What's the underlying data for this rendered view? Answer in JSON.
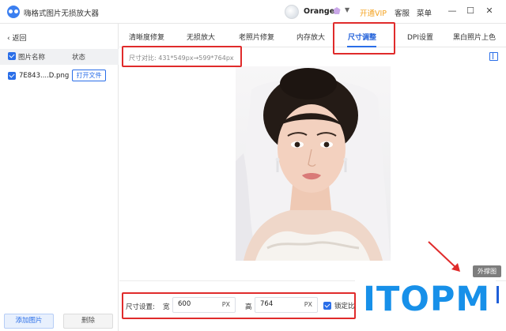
{
  "app": {
    "title": "嗨格式图片无损放大器"
  },
  "user": {
    "name": "Orange",
    "vip_label": "开通VIP",
    "support_label": "客服",
    "menu_label": "菜单"
  },
  "window": {
    "minimize": "—",
    "maximize": "☐",
    "close": "✕"
  },
  "sidebar": {
    "back_label": "返回",
    "columns": {
      "name": "图片名称",
      "status": "状态"
    },
    "files": [
      {
        "name": "7E843....D.png",
        "action": "打开文件"
      }
    ],
    "add_label": "添加图片",
    "delete_label": "删除"
  },
  "tabs": [
    {
      "label": "清晰度修复",
      "active": false
    },
    {
      "label": "无损放大",
      "active": false
    },
    {
      "label": "老照片修复",
      "active": false
    },
    {
      "label": "内存放大",
      "active": false
    },
    {
      "label": "尺寸调整",
      "active": true
    },
    {
      "label": "DPI设置",
      "active": false
    },
    {
      "label": "黑白照片上色",
      "active": false
    }
  ],
  "main": {
    "size_compare": "尺寸对比: 431*549px→599*764px",
    "ext_label": "外撑图"
  },
  "size_settings": {
    "label": "尺寸设置:",
    "width_label": "宽",
    "width_value": "600",
    "width_unit": "PX",
    "height_label": "高",
    "height_value": "764",
    "height_unit": "PX",
    "lock_label": "锁定比"
  },
  "watermark": {
    "text": "ITOPM"
  },
  "colors": {
    "accent": "#2a6ee8",
    "highlight": "#e02b2b",
    "vip": "#f4a321",
    "watermark": "#1790e9"
  }
}
